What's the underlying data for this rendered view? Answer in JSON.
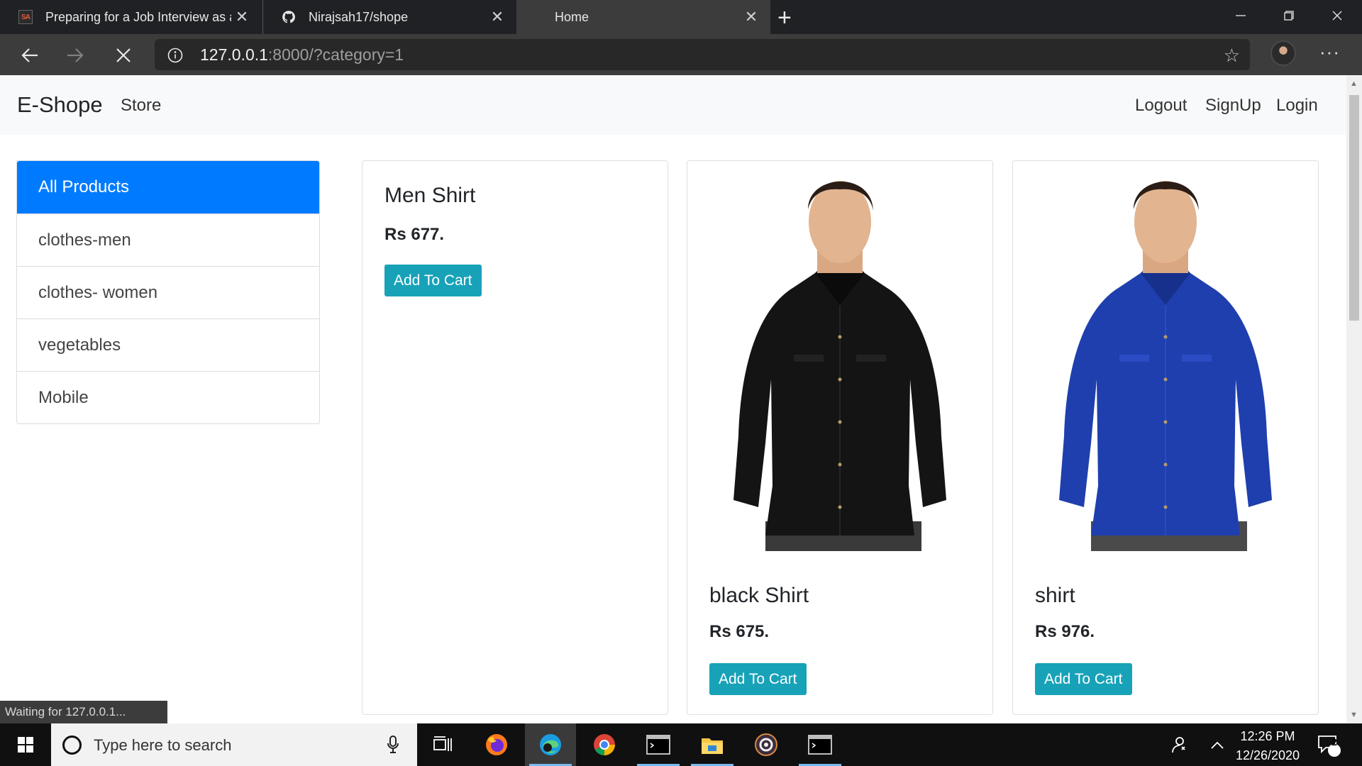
{
  "browser": {
    "tabs": [
      {
        "title": "Preparing for a Job Interview as a",
        "favicon": "sa-icon",
        "active": false
      },
      {
        "title": "Nirajsah17/shope",
        "favicon": "github-icon",
        "active": false
      },
      {
        "title": "Home",
        "favicon": "none",
        "active": true
      }
    ],
    "url_host": "127.0.0.1",
    "url_rest": ":8000/?category=1",
    "status_text": "Waiting for 127.0.0.1..."
  },
  "navbar": {
    "brand": "E-Shope",
    "store": "Store",
    "links": [
      "Logout",
      "SignUp",
      "Login"
    ]
  },
  "sidebar": {
    "items": [
      {
        "label": "All Products",
        "active": true
      },
      {
        "label": "clothes-men",
        "active": false
      },
      {
        "label": "clothes- women",
        "active": false
      },
      {
        "label": "vegetables",
        "active": false
      },
      {
        "label": "Mobile",
        "active": false
      }
    ]
  },
  "products": [
    {
      "name": "Men Shirt",
      "price": "Rs 677.",
      "button": "Add To Cart",
      "image": "none"
    },
    {
      "name": "black Shirt",
      "price": "Rs 675.",
      "button": "Add To Cart",
      "image": "black-shirt-photo",
      "shirt_color": "#141414"
    },
    {
      "name": "shirt",
      "price": "Rs 976.",
      "button": "Add To Cart",
      "image": "blue-shirt-photo",
      "shirt_color": "#1f3fae"
    }
  ],
  "taskbar": {
    "search_placeholder": "Type here to search",
    "time": "12:26 PM",
    "date": "12/26/2020",
    "notification_count": "2"
  },
  "colors": {
    "primary": "#007bff",
    "button": "#17a2b8",
    "navbar_bg": "#f8f9fa"
  }
}
